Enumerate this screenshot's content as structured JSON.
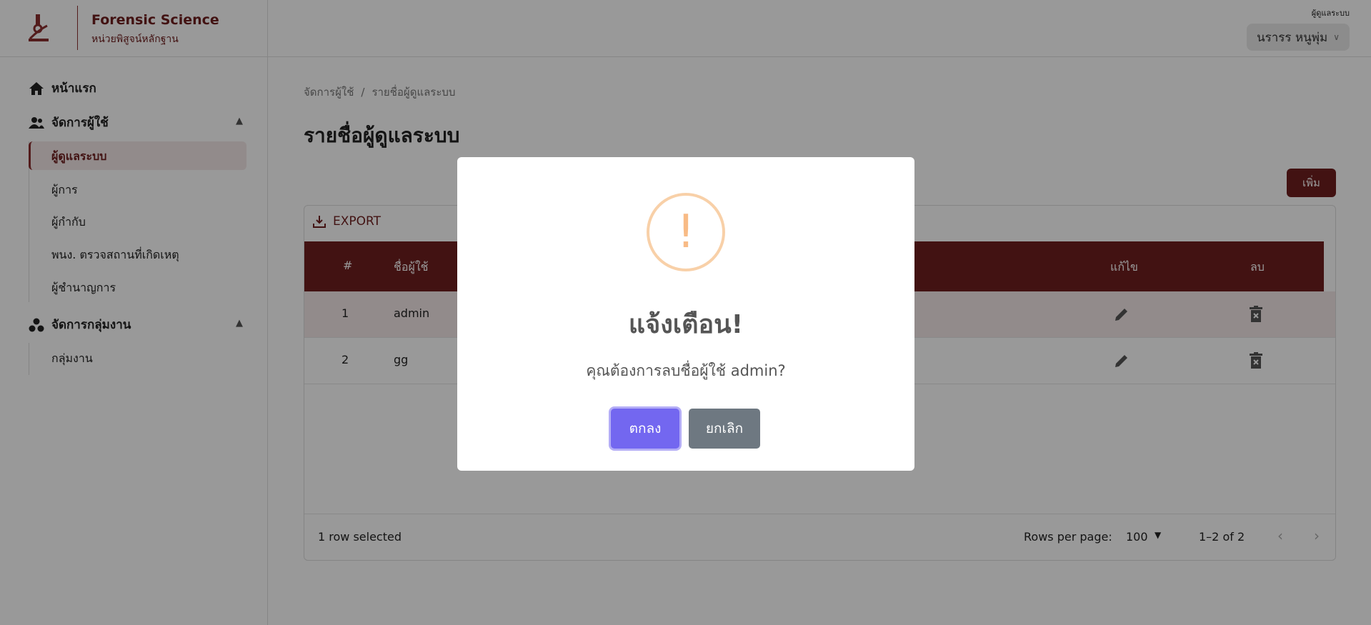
{
  "header": {
    "brand_title": "Forensic Science",
    "brand_subtitle": "หน่วยพิสูจน์หลักฐาน",
    "user_role": "ผู้ดูแลระบบ",
    "user_name": "นรารร หนูพุ่ม"
  },
  "sidebar": {
    "home": "หน้าแรก",
    "user_mgmt": "จัดการผู้ใช้",
    "user_items": [
      "ผู้ดูแลระบบ",
      "ผู้การ",
      "ผู้กำกับ",
      "พนง. ตรวจสถานที่เกิดเหตุ",
      "ผู้ชำนาญการ"
    ],
    "group_mgmt": "จัดการกลุ่มงาน",
    "group_items": [
      "กลุ่มงาน"
    ]
  },
  "main": {
    "breadcrumb": [
      "จัดการผู้ใช้",
      "รายชื่อผู้ดูแลระบบ"
    ],
    "breadcrumb_sep": "/",
    "title": "รายชื่อผู้ดูแลระบบ",
    "add_label": "เพิ่ม",
    "export_label": "EXPORT",
    "columns": {
      "num": "#",
      "username": "ชื่อผู้ใช้",
      "edit": "แก้ไข",
      "delete": "ลบ"
    },
    "rows": [
      {
        "num": "1",
        "username": "admin",
        "selected": true
      },
      {
        "num": "2",
        "username": "gg",
        "selected": false
      }
    ],
    "footer": {
      "selected_text": "1 row selected",
      "rows_per_page_label": "Rows per page:",
      "rows_per_page_value": "100",
      "range": "1–2 of 2"
    }
  },
  "dialog": {
    "icon": "!",
    "title": "แจ้งเตือน!",
    "message": "คุณต้องการลบชื่อผู้ใช้ admin?",
    "confirm_label": "ตกลง",
    "cancel_label": "ยกเลิก"
  },
  "colors": {
    "brand": "#6e1f1f",
    "confirm": "#7367f0",
    "cancel": "#6e7881",
    "warning": "#f8bb86"
  }
}
